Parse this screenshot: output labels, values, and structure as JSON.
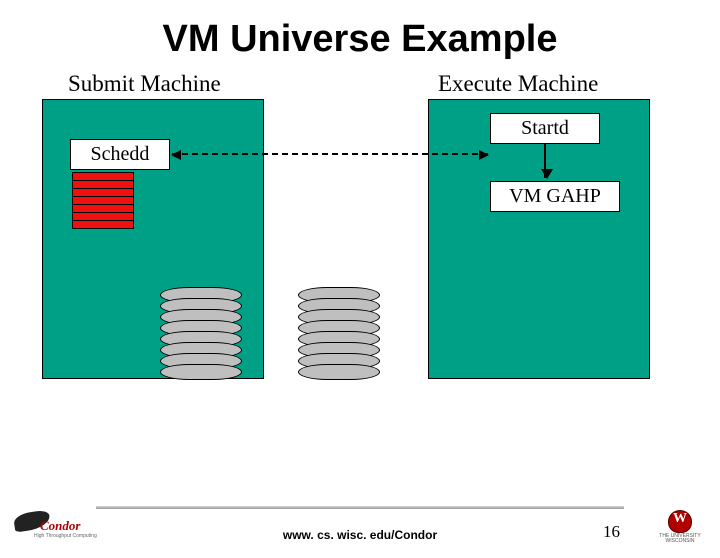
{
  "title": "VM Universe Example",
  "labels": {
    "submit": "Submit Machine",
    "execute": "Execute Machine"
  },
  "boxes": {
    "schedd": "Schedd",
    "startd": "Startd",
    "vmgahp": "VM GAHP"
  },
  "footer": {
    "url": "www. cs. wisc. edu/Condor",
    "slide": "16",
    "left_logo": "Condor",
    "left_logo_sub": "High Throughput Computing",
    "right_logo_line1": "THE UNIVERSITY",
    "right_logo_line2": "WISCONSIN"
  }
}
